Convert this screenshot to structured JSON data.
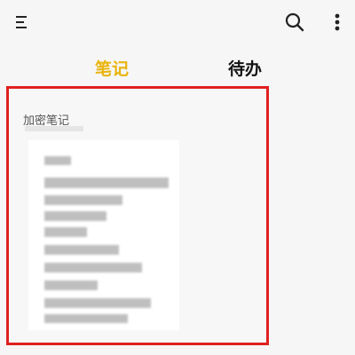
{
  "header": {
    "menu_icon": "menu-icon",
    "search_icon": "search-icon",
    "more_icon": "more-vertical-icon"
  },
  "tabs": [
    {
      "label": "笔记",
      "active": true
    },
    {
      "label": "待办",
      "active": false
    }
  ],
  "colors": {
    "active_tab": "#e9b40c",
    "indicator": "#f2c318",
    "highlight_border": "#e02020",
    "inactive_tab": "#111111"
  },
  "card": {
    "title": "加密笔记",
    "content_blurred": true
  }
}
